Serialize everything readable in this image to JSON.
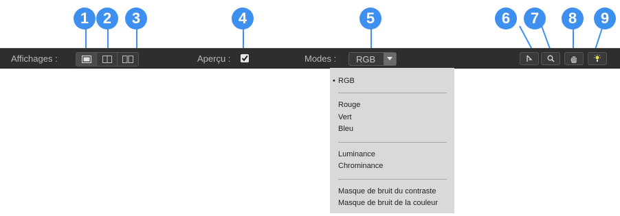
{
  "callouts": [
    "1",
    "2",
    "3",
    "4",
    "5",
    "6",
    "7",
    "8",
    "9"
  ],
  "toolbar": {
    "views_label": "Affichages :",
    "preview_label": "Aperçu :",
    "preview_checked": true,
    "modes_label": "Modes :",
    "mode_value": "RGB"
  },
  "icons": {
    "view_single": "single-view-icon",
    "view_split_vertical": "split-view-icon",
    "view_side_by_side": "side-by-side-view-icon",
    "select": "arrow-pointer-icon",
    "zoom": "magnifier-icon",
    "pan": "hand-icon",
    "light": "light-bulb-icon"
  },
  "menu": {
    "selected": "RGB",
    "groups": [
      [
        "RGB"
      ],
      [
        "Rouge",
        "Vert",
        "Bleu"
      ],
      [
        "Luminance",
        "Chrominance"
      ],
      [
        "Masque de bruit du contraste",
        "Masque de bruit de la couleur"
      ]
    ]
  },
  "colors": {
    "callout": "#3d8ff0",
    "toolbar": "#2e2e2e",
    "menu_bg": "#d9d9d9"
  }
}
